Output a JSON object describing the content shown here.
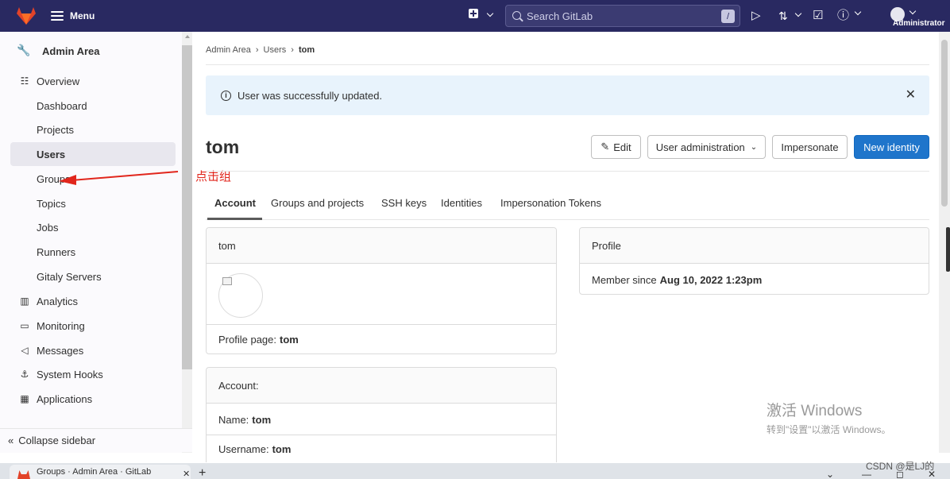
{
  "topbar": {
    "menu_label": "Menu",
    "search_placeholder": "Search GitLab",
    "search_shortcut": "/",
    "user_label": "Administrator"
  },
  "sidebar": {
    "header": "Admin Area",
    "items": [
      {
        "label": "Overview",
        "icon": "overview-icon"
      },
      {
        "label": "Dashboard"
      },
      {
        "label": "Projects"
      },
      {
        "label": "Users",
        "active": true
      },
      {
        "label": "Groups"
      },
      {
        "label": "Topics"
      },
      {
        "label": "Jobs"
      },
      {
        "label": "Runners"
      },
      {
        "label": "Gitaly Servers"
      },
      {
        "label": "Analytics",
        "icon": "analytics-icon"
      },
      {
        "label": "Monitoring",
        "icon": "monitoring-icon"
      },
      {
        "label": "Messages",
        "icon": "messages-icon"
      },
      {
        "label": "System Hooks",
        "icon": "hook-icon"
      },
      {
        "label": "Applications",
        "icon": "applications-icon"
      }
    ],
    "collapse_label": "Collapse sidebar"
  },
  "annotation": {
    "text": "点击组",
    "color": "#e1261c"
  },
  "breadcrumb": {
    "items": [
      "Admin Area",
      "Users"
    ],
    "current": "tom"
  },
  "alert": {
    "message": "User was successfully updated.",
    "background": "#e8f3fc"
  },
  "page": {
    "title": "tom",
    "buttons": {
      "edit": "Edit",
      "user_admin": "User administration",
      "impersonate": "Impersonate",
      "new_identity": "New identity"
    }
  },
  "tabs": [
    "Account",
    "Groups and projects",
    "SSH keys",
    "Identities",
    "Impersonation Tokens"
  ],
  "user_card": {
    "header": "tom",
    "profile_page_label": "Profile page:",
    "profile_page_value": "tom"
  },
  "account_card": {
    "header": "Account:",
    "name_label": "Name:",
    "name_value": "tom",
    "username_label": "Username:",
    "username_value": "tom"
  },
  "profile_card": {
    "header": "Profile",
    "member_since_label": "Member since",
    "member_since_value": "Aug 10, 2022 1:23pm"
  },
  "watermark": {
    "line1": "激活 Windows",
    "line2": "转到\"设置\"以激活 Windows。"
  },
  "browser": {
    "tab_title": "Groups · Admin Area · GitLab",
    "csdn_tag": "CSDN @是LJ的"
  },
  "colors": {
    "navbar": "#292961",
    "primary": "#1f75cb"
  }
}
